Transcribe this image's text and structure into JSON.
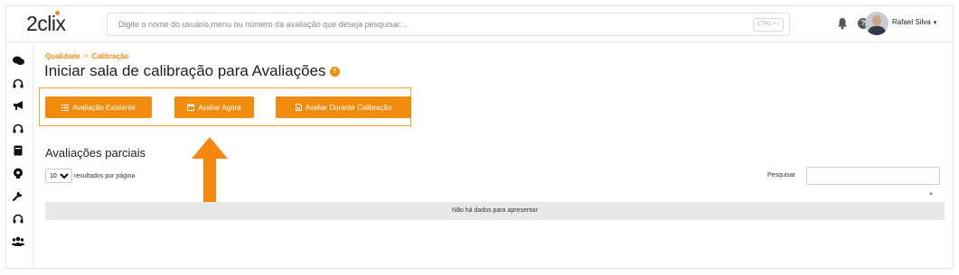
{
  "header": {
    "logo_text": "2clix",
    "search_placeholder": "Digite o nome do usuário,menu ou número da avaliação que deseja pesquisar...",
    "shortcut": "CTRL + /",
    "help_label": "?",
    "user_name": "Rafael Silva",
    "user_caret": "▾"
  },
  "sidebar": {
    "icons": [
      "chat-icon",
      "headset-icon",
      "megaphone-icon",
      "headset-icon",
      "book-icon",
      "brain-icon",
      "wrench-icon",
      "headset-icon",
      "users-icon"
    ]
  },
  "breadcrumb": {
    "items": [
      "Qualidade",
      "Calibração"
    ],
    "separator": ">"
  },
  "page": {
    "title": "Iniciar sala de calibração para Avaliações",
    "title_help": "?"
  },
  "actions": {
    "existing": "Avaliação Existente",
    "now": "Avaliar Agora",
    "during": "Avaliar Durante Calibração"
  },
  "partial": {
    "title": "Avaliações parciais",
    "page_size": "10",
    "page_size_suffix": "resultados por página",
    "search_label": "Pesquisar",
    "sort_indicator": "▲",
    "empty_message": "Não há dados para apresentar"
  },
  "colors": {
    "accent": "#f28c0f",
    "button_border_box": "#f5a623",
    "empty_row_bg": "#e8e8e8"
  }
}
